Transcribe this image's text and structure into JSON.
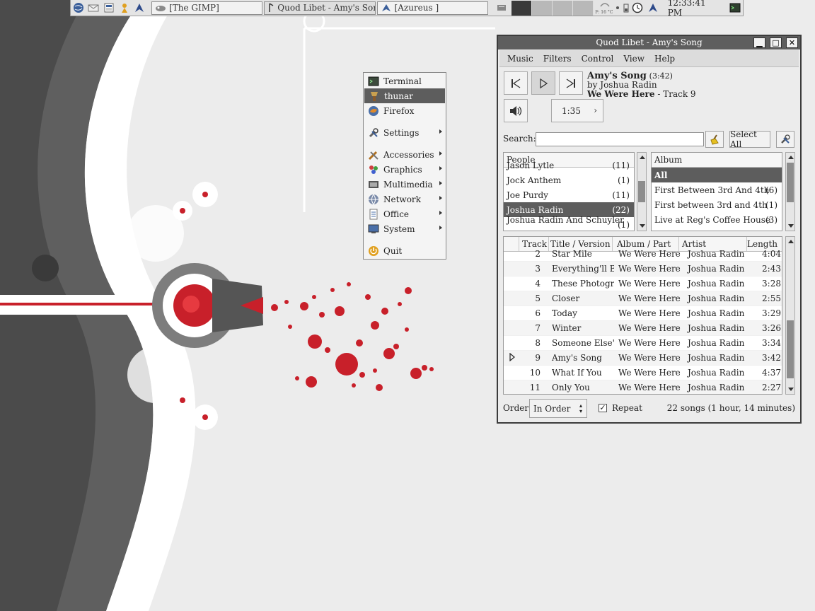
{
  "panel": {
    "tasks": [
      {
        "label": "[The GIMP]",
        "icon": "gimp-icon"
      },
      {
        "label": "Quod Libet - Amy's Song",
        "icon": "quodlibet-icon"
      },
      {
        "label": "[Azureus ]",
        "icon": "azureus-icon"
      }
    ],
    "cpu_temp": "F: 16 °C",
    "clock": "12:33:41 PM"
  },
  "menu": {
    "items": [
      {
        "label": "Terminal",
        "icon": "terminal-icon"
      },
      {
        "label": "thunar",
        "icon": "file-manager-icon"
      },
      {
        "label": "Firefox",
        "icon": "firefox-icon"
      },
      {
        "label": "Settings",
        "icon": "settings-icon"
      },
      {
        "label": "Accessories",
        "icon": "accessories-icon"
      },
      {
        "label": "Graphics",
        "icon": "graphics-icon"
      },
      {
        "label": "Multimedia",
        "icon": "multimedia-icon"
      },
      {
        "label": "Network",
        "icon": "network-icon"
      },
      {
        "label": "Office",
        "icon": "office-icon"
      },
      {
        "label": "System",
        "icon": "system-icon"
      },
      {
        "label": "Quit",
        "icon": "quit-icon"
      }
    ]
  },
  "ql": {
    "title": "Quod Libet - Amy's Song",
    "menubar": [
      "Music",
      "Filters",
      "Control",
      "View",
      "Help"
    ],
    "song": {
      "title": "Amy's Song",
      "length": "(3:42)",
      "by": "by Joshua Radin",
      "album": "We Were Here",
      "track": " - Track 9"
    },
    "position": "1:35",
    "search_label": "Search:",
    "select_all": "Select All",
    "people_header": "People",
    "people": [
      {
        "name": "Jason Lytle",
        "count": "(11)"
      },
      {
        "name": "Jock Anthem",
        "count": "(1)"
      },
      {
        "name": "Joe Purdy",
        "count": "(11)"
      },
      {
        "name": "Joshua Radin",
        "count": "(22)"
      },
      {
        "name": "Joshua Radin And Schuyler ...",
        "count": "(1)"
      }
    ],
    "album_header": "Album",
    "albums": [
      {
        "name": "All",
        "count": ""
      },
      {
        "name": "First Between 3rd And 4th",
        "count": "(6)"
      },
      {
        "name": "First between 3rd and 4th",
        "count": "(1)"
      },
      {
        "name": "Live at Reg's Coffee House",
        "count": "(3)"
      }
    ],
    "columns": [
      "Track",
      "Title / Version",
      "Album / Part",
      "Artist",
      "Length"
    ],
    "tracks": [
      {
        "n": "2",
        "title": "Star Mile",
        "album": "We Were Here",
        "artist": "Joshua Radin",
        "len": "4:04"
      },
      {
        "n": "3",
        "title": "Everything'll B...",
        "album": "We Were Here",
        "artist": "Joshua Radin",
        "len": "2:43"
      },
      {
        "n": "4",
        "title": "These Photogr...",
        "album": "We Were Here",
        "artist": "Joshua Radin",
        "len": "3:28"
      },
      {
        "n": "5",
        "title": "Closer",
        "album": "We Were Here",
        "artist": "Joshua Radin",
        "len": "2:55"
      },
      {
        "n": "6",
        "title": "Today",
        "album": "We Were Here",
        "artist": "Joshua Radin",
        "len": "3:29"
      },
      {
        "n": "7",
        "title": "Winter",
        "album": "We Were Here",
        "artist": "Joshua Radin",
        "len": "3:26"
      },
      {
        "n": "8",
        "title": "Someone Else'...",
        "album": "We Were Here",
        "artist": "Joshua Radin",
        "len": "3:34"
      },
      {
        "n": "9",
        "title": "Amy's Song",
        "album": "We Were Here",
        "artist": "Joshua Radin",
        "len": "3:42"
      },
      {
        "n": "10",
        "title": "What If You",
        "album": "We Were Here",
        "artist": "Joshua Radin",
        "len": "4:37"
      },
      {
        "n": "11",
        "title": "Only You",
        "album": "We Were Here",
        "artist": "Joshua Radin",
        "len": "2:27"
      }
    ],
    "order_label": "Order:",
    "order_value": "In Order",
    "repeat_label": "Repeat",
    "summary": "22 songs (1 hour, 14 minutes)"
  }
}
